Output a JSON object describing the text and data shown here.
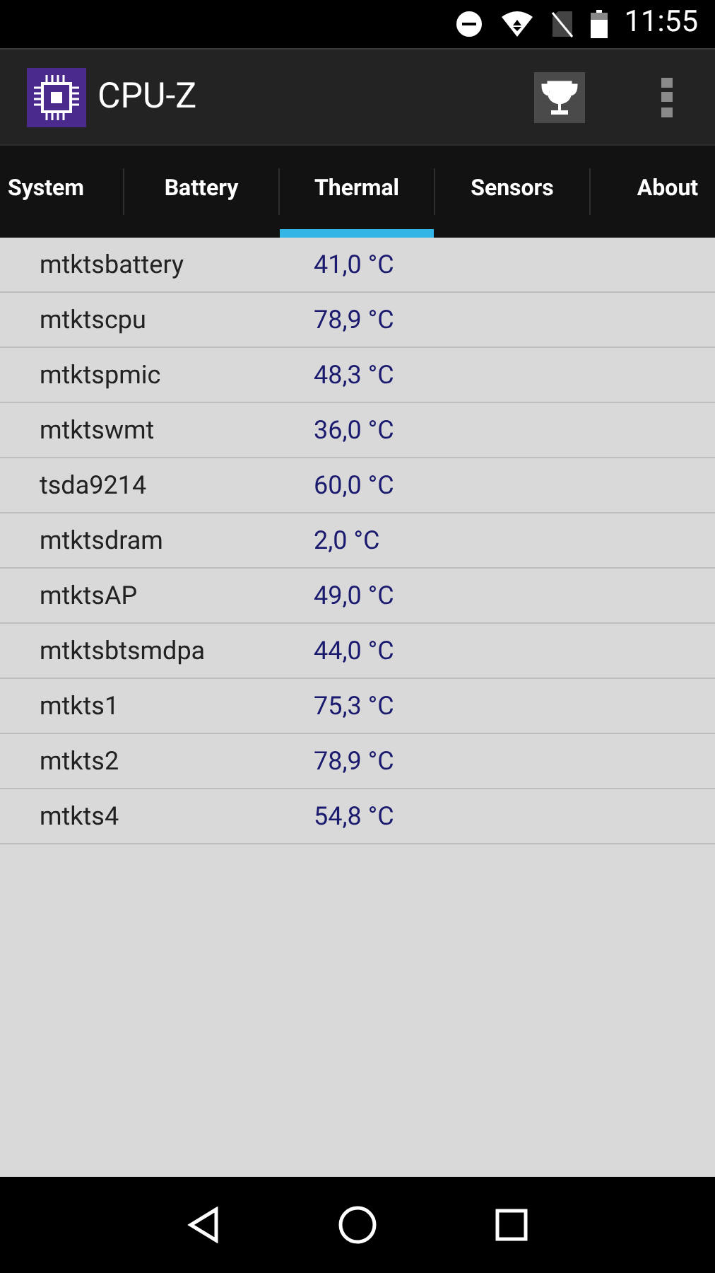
{
  "status_bar": {
    "time": "11:55"
  },
  "app_bar": {
    "title": "CPU-Z"
  },
  "tabs": [
    {
      "label": "System",
      "selected": false
    },
    {
      "label": "Battery",
      "selected": false
    },
    {
      "label": "Thermal",
      "selected": true
    },
    {
      "label": "Sensors",
      "selected": false
    },
    {
      "label": "About",
      "selected": false
    }
  ],
  "rows": [
    {
      "name": "mtktsbattery",
      "value": "41,0 °C"
    },
    {
      "name": "mtktscpu",
      "value": "78,9 °C"
    },
    {
      "name": "mtktspmic",
      "value": "48,3 °C"
    },
    {
      "name": "mtktswmt",
      "value": "36,0 °C"
    },
    {
      "name": "tsda9214",
      "value": "60,0 °C"
    },
    {
      "name": "mtktsdram",
      "value": "2,0 °C"
    },
    {
      "name": "mtktsAP",
      "value": "49,0 °C"
    },
    {
      "name": "mtktsbtsmdpa",
      "value": "44,0 °C"
    },
    {
      "name": "mtkts1",
      "value": "75,3 °C"
    },
    {
      "name": "mtkts2",
      "value": "78,9 °C"
    },
    {
      "name": "mtkts4",
      "value": "54,8 °C"
    }
  ]
}
